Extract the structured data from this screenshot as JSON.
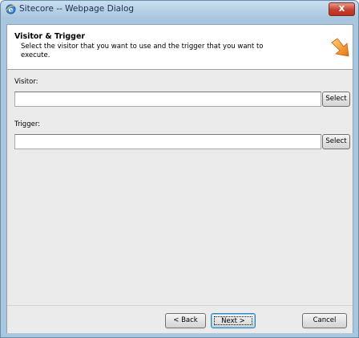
{
  "window": {
    "title": "Sitecore -- Webpage Dialog",
    "icon": "ie-icon",
    "close_symbol": "x"
  },
  "header": {
    "title": "Visitor & Trigger",
    "description": "Select the visitor that you want to use and the trigger that you want to execute.",
    "icon": "arrow-icon"
  },
  "form": {
    "visitor_label": "Visitor:",
    "visitor_value": "",
    "visitor_select_label": "Select",
    "trigger_label": "Trigger:",
    "trigger_value": "",
    "trigger_select_label": "Select"
  },
  "footer": {
    "back_label": "< Back",
    "next_label": "Next >",
    "cancel_label": "Cancel"
  },
  "colors": {
    "title_bar": "#a9c6df",
    "close_button": "#c7402e",
    "arrow": "#f08a1c",
    "body_background": "#ebebeb"
  }
}
